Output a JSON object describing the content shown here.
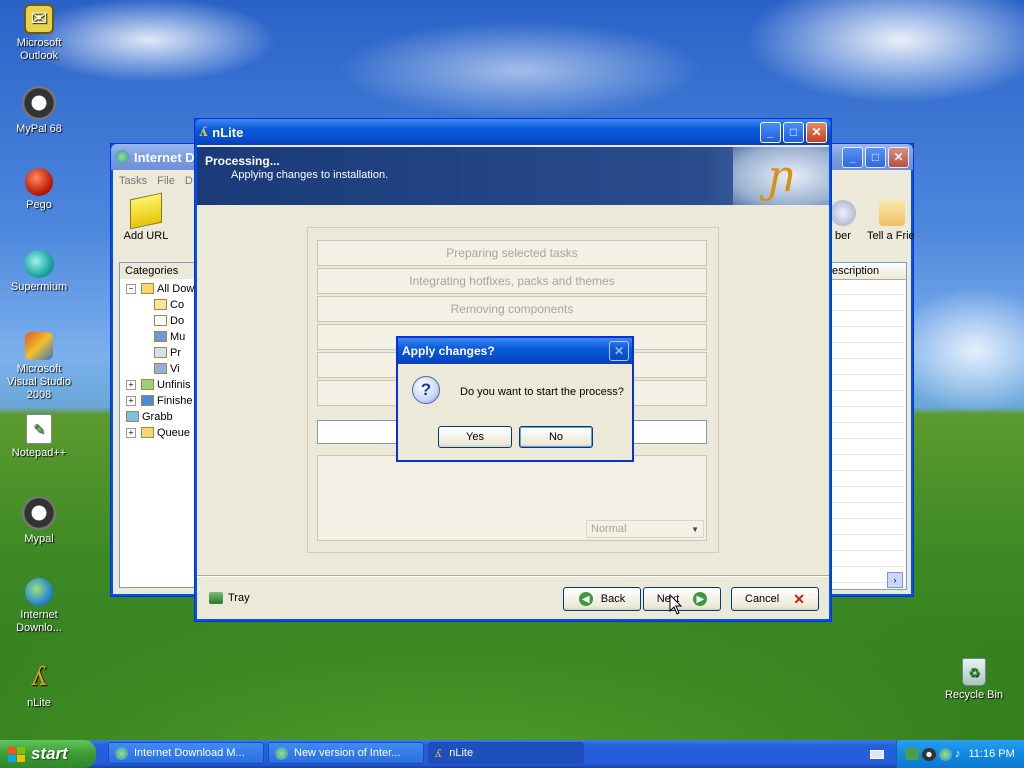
{
  "desktop": {
    "icons": [
      {
        "label": "Microsoft Outlook"
      },
      {
        "label": "MyPal 68"
      },
      {
        "label": "Pego"
      },
      {
        "label": "Supermium"
      },
      {
        "label": "Microsoft Visual Studio 2008"
      },
      {
        "label": "Notepad++"
      },
      {
        "label": "Mypal"
      },
      {
        "label": "Internet Downlo..."
      },
      {
        "label": "nLite"
      },
      {
        "label": "Recycle Bin"
      }
    ]
  },
  "idm_window": {
    "title": "Internet D",
    "menu": [
      "Tasks",
      "File",
      "D"
    ],
    "add_url_label": "Add URL",
    "right_toolbar": [
      "ber",
      "Tell a Frie"
    ],
    "categories_label": "Categories",
    "tree": [
      {
        "label": "All Dow"
      },
      {
        "label": "Co"
      },
      {
        "label": "Do"
      },
      {
        "label": "Mu"
      },
      {
        "label": "Pr"
      },
      {
        "label": "Vi"
      },
      {
        "label": "Unfinis"
      },
      {
        "label": "Finishe"
      },
      {
        "label": "Grabb"
      },
      {
        "label": "Queue"
      }
    ],
    "column_header": "escription"
  },
  "nlite": {
    "title": "nLite",
    "header_title": "Processing...",
    "header_subtitle": "Applying changes to installation.",
    "steps": [
      "Preparing selected tasks",
      "Integrating hotfixes, packs and themes",
      "Removing components",
      "",
      "",
      ""
    ],
    "priority_value": "Normal",
    "tray_label": "Tray",
    "back_label": "Back",
    "next_label": "Next",
    "cancel_label": "Cancel"
  },
  "dialog": {
    "title": "Apply changes?",
    "message": "Do you want to start the process?",
    "yes_label": "Yes",
    "no_label": "No"
  },
  "taskbar": {
    "start_label": "start",
    "items": [
      {
        "label": "Internet Download M..."
      },
      {
        "label": "New version of Inter..."
      },
      {
        "label": "nLite"
      }
    ],
    "clock": "11:16 PM"
  },
  "colors": {
    "taskbar_blue": "#245edb",
    "start_green": "#3c9b33",
    "nlite_header": "#1f3f7a",
    "dialog_border": "#0831d9"
  }
}
